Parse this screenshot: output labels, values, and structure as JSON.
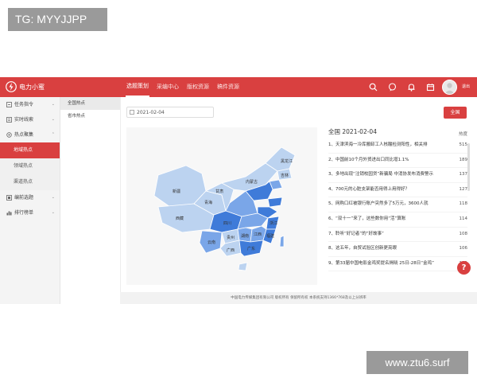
{
  "watermark_top": "TG: MYYJJPP",
  "watermark_bottom": "www.ztu6.surf",
  "header": {
    "brand": "电力小蜜",
    "nav": [
      "选题策划",
      "采编中心",
      "版权资源",
      "稿件资源"
    ],
    "icons": [
      "search-icon",
      "chat-icon",
      "bell-icon",
      "calendar-icon"
    ],
    "user": "退出"
  },
  "sidebar": {
    "items": [
      {
        "label": "任务指令",
        "icon": "task-icon"
      },
      {
        "label": "实时线索",
        "icon": "clue-icon"
      },
      {
        "label": "热点聚集",
        "icon": "hot-icon"
      }
    ],
    "sub_items": [
      "地域热点",
      "领域热点",
      "渠道热点"
    ],
    "items_after": [
      {
        "label": "编前选题",
        "icon": "topic-icon"
      },
      {
        "label": "排行榜单",
        "icon": "rank-icon"
      }
    ]
  },
  "subpanel": [
    "全国热点",
    "省市热点"
  ],
  "toolbar": {
    "date": "2021-02-04",
    "button": "全国"
  },
  "ranking": {
    "title": "全国  2021-02-04",
    "col_header": "热度",
    "rows": [
      {
        "text": "1、天津滨海一冷库搬卸工人核酸检测阳性，相关排",
        "value": "515"
      },
      {
        "text": "2、中国前10个月外贸进出口同比增1.1%",
        "value": "189"
      },
      {
        "text": "3、多地出现“注销校园贷”新骗局 中消协发布消费警示",
        "value": "137"
      },
      {
        "text": "4、700元的心脏支架能否用得上用得好？",
        "value": "127"
      },
      {
        "text": "5、网购口红被银行账户突然多了5万元，3600人就",
        "value": "118"
      },
      {
        "text": "6、“双十一”来了，这些数你用“活”算账",
        "value": "114"
      },
      {
        "text": "7、聆听“好记者”的“好故事”",
        "value": "108"
      },
      {
        "text": "8、这五年，自贸试验区创新更亮眼",
        "value": "106"
      },
      {
        "text": "9、第33届中国电影金鸡奖提名揭晓 25日-28日“金鸡”",
        "value": "101"
      }
    ]
  },
  "map_labels": [
    "新疆",
    "西藏",
    "青海",
    "甘肃",
    "内蒙古",
    "黑龙江",
    "吉林",
    "四川",
    "云南",
    "贵州",
    "湖南",
    "江西",
    "广东",
    "广西",
    "浙江",
    "福建"
  ],
  "colors": {
    "brand": "#d94040",
    "map_light": "#bcd3f0",
    "map_mid": "#7aa6e8",
    "map_dark": "#3f7bd9"
  },
  "footer": "中国电力传媒集团有限公司  版权所有  保留所有权  本系统支持1366*768及以上分辨率"
}
